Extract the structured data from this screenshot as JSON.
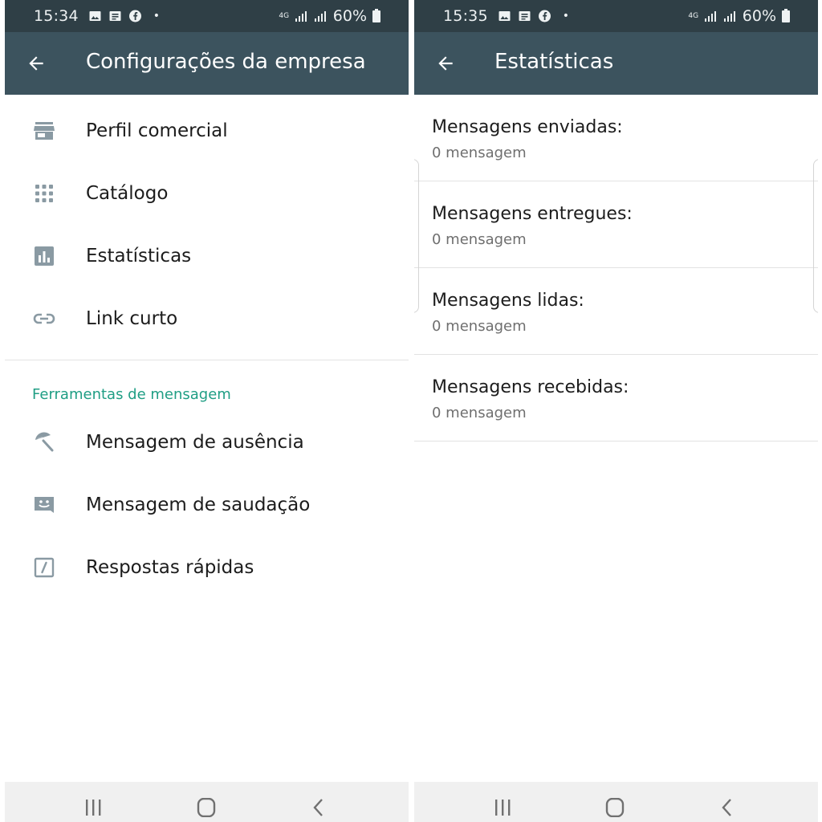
{
  "left": {
    "status": {
      "time": "15:34",
      "network": "4G",
      "battery": "60%"
    },
    "appbar": {
      "title": "Configurações da empresa"
    },
    "items": [
      {
        "label": "Perfil comercial",
        "icon": "store-icon"
      },
      {
        "label": "Catálogo",
        "icon": "grid-icon"
      },
      {
        "label": "Estatísticas",
        "icon": "bar-chart-icon"
      },
      {
        "label": "Link curto",
        "icon": "link-icon"
      }
    ],
    "section": "Ferramentas de mensagem",
    "tools": [
      {
        "label": "Mensagem de ausência",
        "icon": "umbrella-icon"
      },
      {
        "label": "Mensagem de saudação",
        "icon": "smiley-message-icon"
      },
      {
        "label": "Respostas rápidas",
        "icon": "slash-box-icon"
      }
    ]
  },
  "right": {
    "status": {
      "time": "15:35",
      "network": "4G",
      "battery": "60%"
    },
    "appbar": {
      "title": "Estatísticas"
    },
    "stats": [
      {
        "label": "Mensagens enviadas:",
        "value": "0 mensagem"
      },
      {
        "label": "Mensagens entregues:",
        "value": "0 mensagem"
      },
      {
        "label": "Mensagens lidas:",
        "value": "0 mensagem"
      },
      {
        "label": "Mensagens recebidas:",
        "value": "0 mensagem"
      }
    ]
  },
  "colors": {
    "status_bar": "#2f3f46",
    "app_bar": "#3c535e",
    "accent": "#1f9e84",
    "icon_gray": "#8a9aa3"
  }
}
